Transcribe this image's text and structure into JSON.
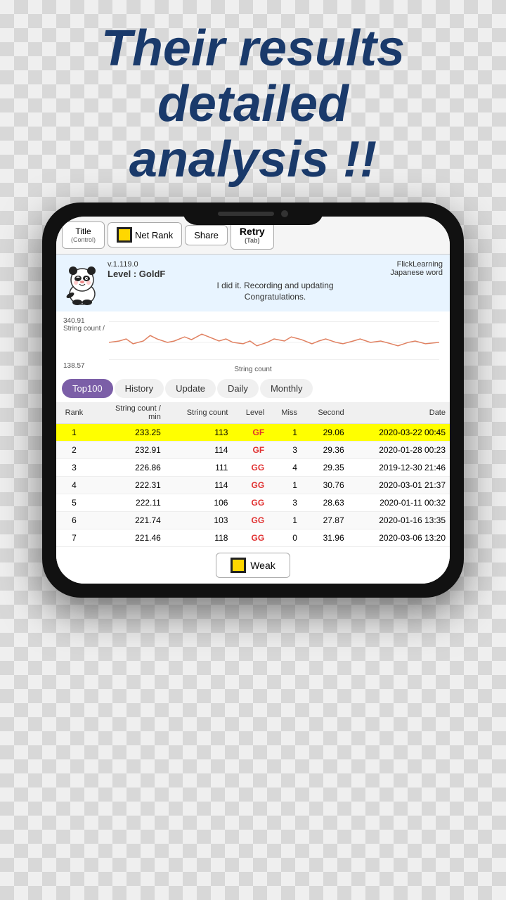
{
  "headline": {
    "line1": "Their results",
    "line2": "detailed",
    "line3": "analysis !!"
  },
  "toolbar": {
    "title_label": "Title",
    "title_sub": "(Control)",
    "netrank_label": "Net Rank",
    "share_label": "Share",
    "retry_label": "Retry",
    "retry_sub": "(Tab)"
  },
  "info": {
    "version": "v.1.119.0",
    "brand": "FlickLearning",
    "level": "Level : GoldF",
    "message": "I did it. Recording and updating",
    "message2": "Congratulations.",
    "language": "Japanese word"
  },
  "chart": {
    "y_top": "340.91",
    "y_label": "String count /",
    "y_bottom": "138.57",
    "x_label": "String count"
  },
  "tabs": [
    {
      "label": "Top100",
      "active": true
    },
    {
      "label": "History",
      "active": false
    },
    {
      "label": "Update",
      "active": false
    },
    {
      "label": "Daily",
      "active": false
    },
    {
      "label": "Monthly",
      "active": false
    }
  ],
  "table": {
    "headers": [
      "Rank",
      "String count /\nmin",
      "String count",
      "Level",
      "Miss",
      "Second",
      "Date"
    ],
    "rows": [
      {
        "rank": "1",
        "spm": "233.25",
        "count": "113",
        "level": "GF",
        "miss": "1",
        "second": "29.06",
        "date": "2020-03-22 00:45",
        "highlight": true
      },
      {
        "rank": "2",
        "spm": "232.91",
        "count": "114",
        "level": "GF",
        "miss": "3",
        "second": "29.36",
        "date": "2020-01-28 00:23",
        "highlight": false
      },
      {
        "rank": "3",
        "spm": "226.86",
        "count": "111",
        "level": "GG",
        "miss": "4",
        "second": "29.35",
        "date": "2019-12-30 21:46",
        "highlight": false
      },
      {
        "rank": "4",
        "spm": "222.31",
        "count": "114",
        "level": "GG",
        "miss": "1",
        "second": "30.76",
        "date": "2020-03-01 21:37",
        "highlight": false
      },
      {
        "rank": "5",
        "spm": "222.11",
        "count": "106",
        "level": "GG",
        "miss": "3",
        "second": "28.63",
        "date": "2020-01-11 00:32",
        "highlight": false
      },
      {
        "rank": "6",
        "spm": "221.74",
        "count": "103",
        "level": "GG",
        "miss": "1",
        "second": "27.87",
        "date": "2020-01-16 13:35",
        "highlight": false
      },
      {
        "rank": "7",
        "spm": "221.46",
        "count": "118",
        "level": "GG",
        "miss": "0",
        "second": "31.96",
        "date": "2020-03-06 13:20",
        "highlight": false
      }
    ]
  },
  "weak_button": {
    "label": "Weak"
  }
}
